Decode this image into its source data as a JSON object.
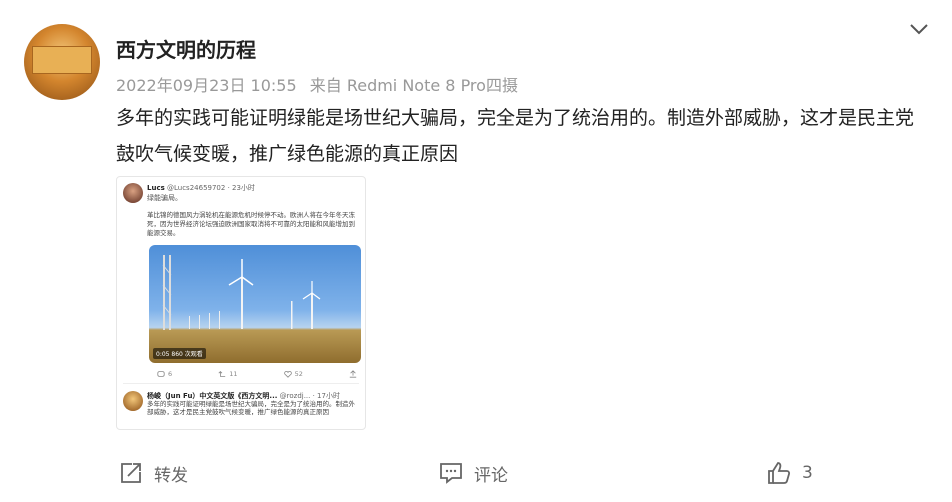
{
  "post": {
    "username": "西方文明的历程",
    "timestamp": "2022年09月23日 10:55",
    "source": "来自 Redmi Note 8 Pro四摄",
    "text": "多年的实践可能证明绿能是场世纪大骗局，完全是为了统治用的。制造外部威胁，这才是民主党鼓吹气候变暖，推广绿色能源的真正原因"
  },
  "embed": {
    "tweet1": {
      "name": "Lucs",
      "handle": "@Lucs24659702 · 23小时",
      "sub": "绿能骗局。",
      "body": "革比锦的德国风力涡轮机在能源危机时候停不动。欧洲人将在今年冬天冻死，因为世界经济论坛强迫欧洲国家取消将不可靠的太阳能和风能增加到能源交易。",
      "video_time": "0:05",
      "video_views": "860 次观看",
      "replies": "6",
      "retweets": "11",
      "likes": "52"
    },
    "tweet2": {
      "name": "杨峻（Jun Fu）中文英文版《西方文明...",
      "handle": "@rozdj... · 17小时",
      "body": "多年的实践可能证明绿能是场世纪大骗局，完全是为了统治用的。制造外部威胁，这才是民主党鼓吹气候变暖，推广绿色能源的真正原因"
    }
  },
  "actions": {
    "repost_label": "转发",
    "comment_label": "评论",
    "like_count": "3"
  },
  "colors": {
    "text_primary": "#222222",
    "text_meta": "#999999",
    "action_gray": "#666666"
  }
}
